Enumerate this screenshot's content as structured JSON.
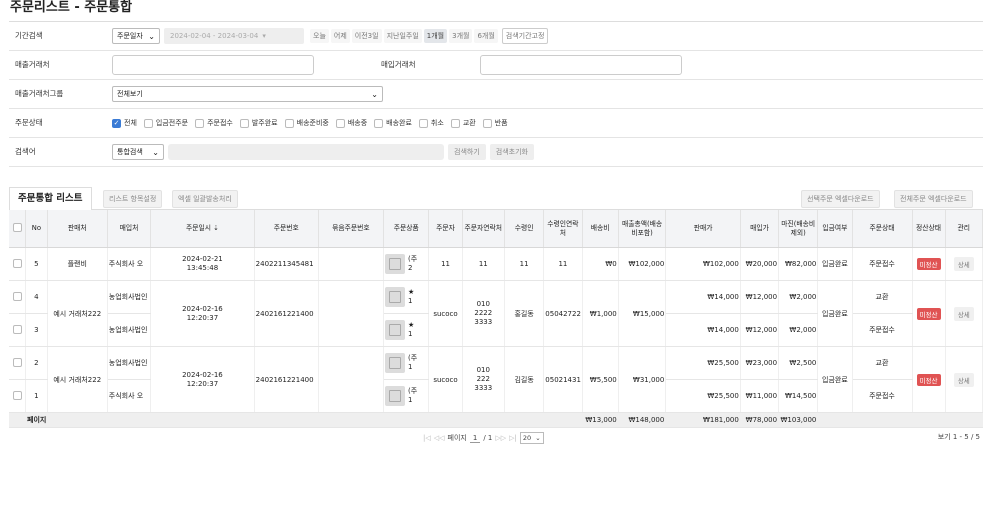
{
  "page_title": "주문리스트 - 주문통합",
  "filters": {
    "period_label": "기간검색",
    "period_select": "주문일자",
    "date_range": "2024-02-04 - 2024-03-04",
    "quick_ranges": [
      "오늘",
      "어제",
      "이전3일",
      "지난일주일",
      "1개월",
      "3개월",
      "6개월"
    ],
    "active_range": "1개월",
    "fix_period": "검색기간고정",
    "sales_label": "매출거래처",
    "purchase_label": "매입거래처",
    "sales_group_label": "매출거래처그룹",
    "sales_group_value": "전체보기",
    "status_label": "주문상태",
    "statuses": [
      {
        "label": "전체",
        "checked": true
      },
      {
        "label": "입금전주문",
        "checked": false
      },
      {
        "label": "주문접수",
        "checked": false
      },
      {
        "label": "발주완료",
        "checked": false
      },
      {
        "label": "배송준비중",
        "checked": false
      },
      {
        "label": "배송중",
        "checked": false
      },
      {
        "label": "배송완료",
        "checked": false
      },
      {
        "label": "취소",
        "checked": false
      },
      {
        "label": "교환",
        "checked": false
      },
      {
        "label": "반품",
        "checked": false
      }
    ],
    "keyword_label": "검색어",
    "keyword_select": "통합검색",
    "search_btn": "검색하기",
    "reset_btn": "검색초기화"
  },
  "list": {
    "tab": "주문통합 리스트",
    "settings_btn": "리스트 항목설정",
    "excel_ship_btn": "엑셀 일괄발송처리",
    "sel_excel_btn": "선택주문 엑셀다운로드",
    "all_excel_btn": "전체주문 엑셀다운로드"
  },
  "columns": [
    "No",
    "판매처",
    "매입처",
    "주문일시 ⇣",
    "주문번호",
    "묶음주문번호",
    "주문상품",
    "주문자",
    "주문자연락처",
    "수령인",
    "수령인연락처",
    "배송비",
    "매출총액(배송비포함)",
    "판매가",
    "매입가",
    "마진(배송비제외)",
    "입금여부",
    "주문상태",
    "정산상태",
    "관리"
  ],
  "rows": [
    {
      "no": "5",
      "seller": "플랜비",
      "buyer": "주식회사 오",
      "date": "2024-02-21",
      "time": "13:45:48",
      "order_no": "2402211345481",
      "bundle": "",
      "prod_a": "(주",
      "prod_b": "2",
      "orderer": "11",
      "orderer_tel": "11",
      "receiver": "11",
      "receiver_tel": "11",
      "ship": "₩0",
      "total": "₩102,000",
      "price": "₩102,000",
      "cost": "₩20,000",
      "margin": "₩82,000",
      "paid": "입금완료",
      "status": "주문접수",
      "settle": "미정산",
      "manage": "상세"
    },
    {
      "no": "4",
      "buyer": "농업회사법인",
      "price": "₩14,000",
      "cost": "₩12,000",
      "margin": "₩2,000",
      "status": "교환",
      "prod_a": "★",
      "prod_b": "1"
    },
    {
      "no": "3",
      "buyer": "농업회사법인",
      "price": "₩14,000",
      "cost": "₩12,000",
      "margin": "₩2,000",
      "status": "주문접수",
      "prod_a": "★",
      "prod_b": "1"
    },
    {
      "no": "2",
      "buyer": "농업회사법인",
      "price": "₩25,500",
      "cost": "₩23,000",
      "margin": "₩2,500",
      "status": "교환",
      "prod_a": "(주",
      "prod_b": "1"
    },
    {
      "no": "1",
      "buyer": "주식회사 오",
      "price": "₩25,500",
      "cost": "₩11,000",
      "margin": "₩14,500",
      "status": "주문접수",
      "prod_a": "(주",
      "prod_b": "1"
    }
  ],
  "group_a": {
    "seller": "예시 거래처222",
    "date": "2024-02-16",
    "time": "12:20:37",
    "order_no": "2402161221400",
    "orderer": "sucoco",
    "tel1": "010",
    "tel2": "2222",
    "tel3": "3333",
    "receiver": "홍길동",
    "receiver_tel": "05042722",
    "ship": "₩1,000",
    "total": "₩15,000",
    "paid": "입금완료",
    "settle": "미정산",
    "manage": "상세"
  },
  "group_b": {
    "seller": "예시 거래처222",
    "date": "2024-02-16",
    "time": "12:20:37",
    "order_no": "2402161221400",
    "orderer": "sucoco",
    "tel1": "010",
    "tel2": "222",
    "tel3": "3333",
    "receiver": "김길동",
    "receiver_tel": "05021431",
    "ship": "₩5,500",
    "total": "₩31,000",
    "paid": "입금완료",
    "settle": "미정산",
    "manage": "상세"
  },
  "footer": {
    "label": "페이지",
    "ship": "₩13,000",
    "total": "₩148,000",
    "price": "₩181,000",
    "cost": "₩78,000",
    "margin": "₩103,000"
  },
  "pager": {
    "first": "|◁",
    "prev": "◁◁",
    "label": "페이지",
    "page": "1",
    "of": "/ 1",
    "next": "▷▷",
    "last": "▷|",
    "size": "20",
    "summary": "보기 1 - 5 / 5"
  }
}
